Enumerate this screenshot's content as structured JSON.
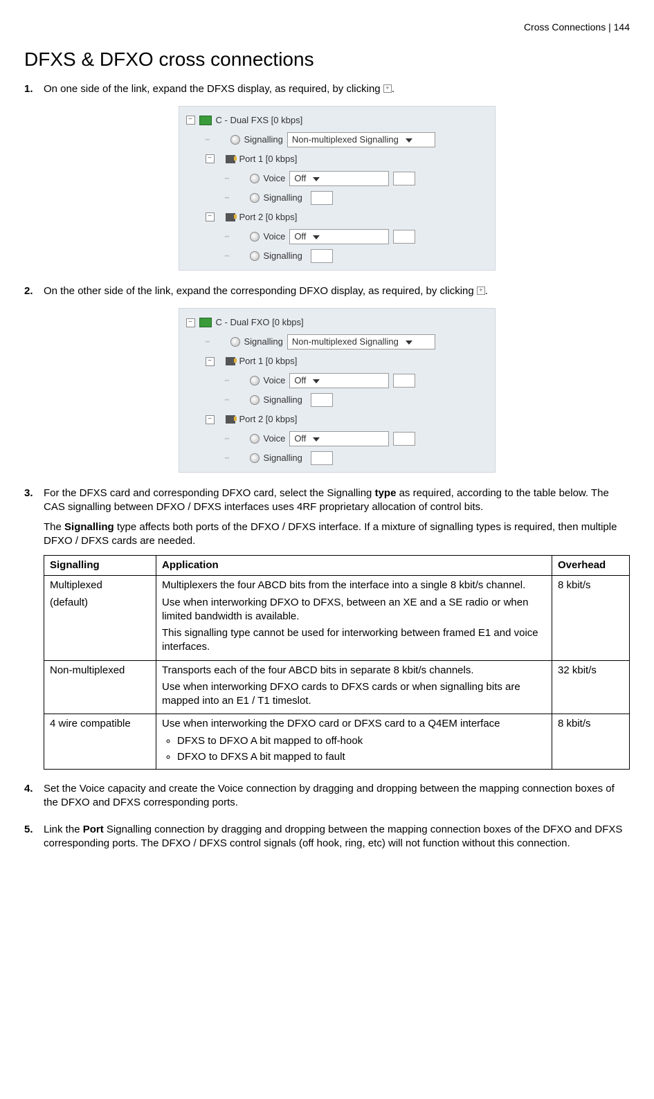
{
  "header": {
    "breadcrumb": "Cross Connections  |  144"
  },
  "title": "DFXS & DFXO cross connections",
  "steps": {
    "s1": {
      "num": "1.",
      "text_a": "On one side of the link, expand the DFXS display, as required, by clicking ",
      "text_b": "."
    },
    "s2": {
      "num": "2.",
      "text_a": "On the other side of the link, expand the corresponding DFXO display, as required, by clicking ",
      "text_b": "."
    },
    "s3": {
      "num": "3.",
      "para1_a": "For the DFXS card and corresponding DFXO card, select the Signalling ",
      "para1_bold": "type",
      "para1_b": " as required, according to the table below. The CAS signalling between DFXO / DFXS interfaces uses 4RF proprietary allocation of control bits.",
      "para2_a": "The ",
      "para2_bold": "Signalling",
      "para2_b": " type affects both ports of the DFXO / DFXS interface. If a mixture of signalling types is required, then multiple DFXO / DFXS cards are needed."
    },
    "s4": {
      "num": "4.",
      "text": "Set the Voice capacity and create the Voice connection by dragging and dropping between the mapping connection boxes of the DFXO and DFXS corresponding ports."
    },
    "s5": {
      "num": "5.",
      "text_a": "Link the ",
      "bold": "Port",
      "text_b": " Signalling connection by dragging and dropping between the mapping connection boxes of the DFXO and DFXS corresponding ports. The DFXO / DFXS control signals (off hook, ring, etc) will not function without this connection."
    }
  },
  "tree1": {
    "root": "C - Dual FXS [0 kbps]",
    "sig_label": "Signalling",
    "sig_value": "Non-multiplexed Signalling",
    "port1": "Port 1 [0 kbps]",
    "port2": "Port 2 [0 kbps]",
    "voice_label": "Voice",
    "voice_value": "Off",
    "port_sig_label": "Signalling",
    "minus": "−",
    "plus": "+"
  },
  "tree2": {
    "root": "C - Dual FXO [0 kbps]",
    "sig_label": "Signalling",
    "sig_value": "Non-multiplexed Signalling",
    "port1": "Port 1 [0 kbps]",
    "port2": "Port 2 [0 kbps]",
    "voice_label": "Voice",
    "voice_value": "Off",
    "port_sig_label": "Signalling",
    "minus": "−"
  },
  "table": {
    "h1": "Signalling",
    "h2": "Application",
    "h3": "Overhead",
    "r1": {
      "c1a": "Multiplexed",
      "c1b": "(default)",
      "c2a": "Multiplexers the four ABCD bits from the interface into a single 8 kbit/s channel.",
      "c2b": "Use when interworking DFXO to DFXS, between an XE and a SE radio or when limited bandwidth is available.",
      "c2c": "This signalling type cannot be used for interworking between framed E1 and voice interfaces.",
      "c3": "8 kbit/s"
    },
    "r2": {
      "c1": "Non-multiplexed",
      "c2a": "Transports each of the four ABCD bits in separate 8 kbit/s channels.",
      "c2b": "Use when interworking DFXO cards to DFXS cards or when signalling bits are mapped into an E1 / T1 timeslot.",
      "c3": "32 kbit/s"
    },
    "r3": {
      "c1": "4 wire compatible",
      "c2a": "Use when interworking the DFXO card or DFXS card to a Q4EM interface",
      "c2b1": "DFXS to DFXO A bit mapped to off-hook",
      "c2b2": "DFXO to DFXS A bit mapped to fault",
      "c3": "8 kbit/s"
    }
  }
}
